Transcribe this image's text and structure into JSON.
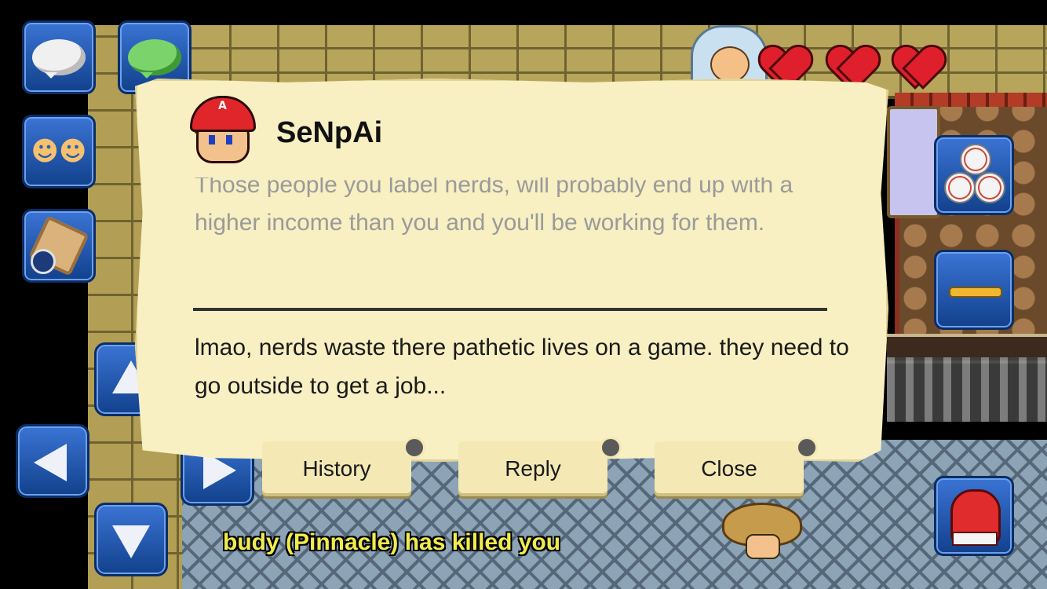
{
  "dialog": {
    "username": "SeNpAi",
    "avatar_letter": "A",
    "previous_message": "Those people you label nerds, will probably end up with a higher income than you and you'll be working for them.",
    "current_message": "lmao, nerds waste there pathetic lives on a game. they need to go outside to get a job...",
    "buttons": {
      "history": "History",
      "reply": "Reply",
      "close": "Close"
    }
  },
  "notification": {
    "kill_message": "budy (Pinnacle) has killed you"
  },
  "hud": {
    "hearts": 3
  },
  "icons": [
    "chat-bubble-white-icon",
    "chat-bubble-green-icon",
    "players-icon",
    "map-compass-icon",
    "arrow-left-icon",
    "arrow-right-icon",
    "arrow-down-icon",
    "arrow-up-icon",
    "baseballs-icon",
    "hat-icon",
    "boxing-glove-icon",
    "heart-icon"
  ],
  "colors": {
    "panel_bg": "#f8efc2",
    "button_blue": "#2a5cb4",
    "kill_text": "#f1ec4e",
    "heart_red": "#e01f2c"
  }
}
